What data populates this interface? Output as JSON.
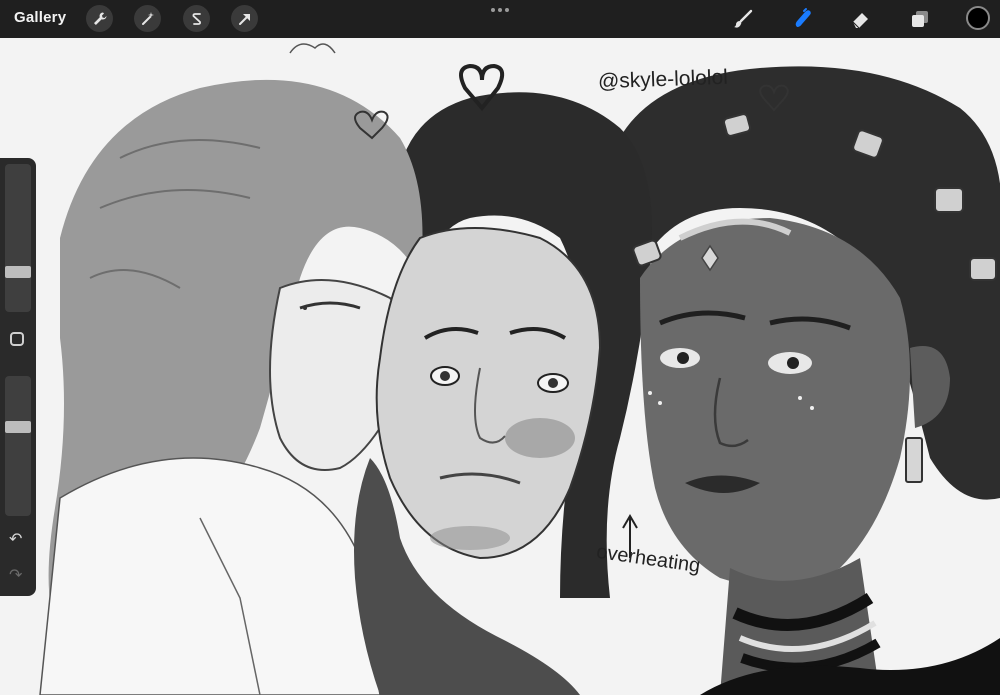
{
  "app": {
    "gallery_label": "Gallery"
  },
  "toolbar": {
    "left_tools": [
      "wrench-icon",
      "magic-wand-icon",
      "selection-s-icon",
      "transform-arrow-icon"
    ],
    "more_label": "•••",
    "right_tools": [
      {
        "icon": "brush-icon",
        "active": false
      },
      {
        "icon": "smudge-icon",
        "active": true
      },
      {
        "icon": "eraser-icon",
        "active": false
      },
      {
        "icon": "layers-icon",
        "active": false
      }
    ],
    "current_color": "#000000",
    "accent_color": "#1a7cff"
  },
  "sidebar": {
    "brush_size_level": 0.25,
    "opacity_level": 0.65,
    "undo_icon": "undo-icon",
    "redo_icon": "redo-icon",
    "modify_icon": "modify-square-icon"
  },
  "artwork": {
    "handle_text": "@skyle-lololol",
    "note_text": "overheating",
    "arrow_symbol": "↑"
  }
}
